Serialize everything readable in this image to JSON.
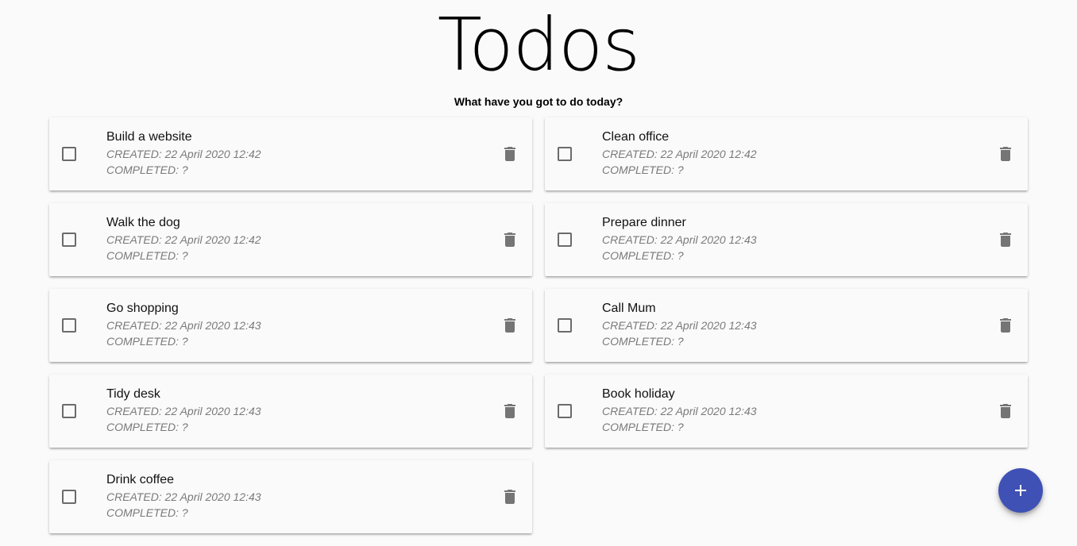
{
  "header": {
    "title": "Todos",
    "subtitle": "What have you got to do today?"
  },
  "todos": [
    {
      "title": "Build a website",
      "created": "CREATED: 22 April 2020 12:42",
      "completed": "COMPLETED: ?",
      "checked": false
    },
    {
      "title": "Clean office",
      "created": "CREATED: 22 April 2020 12:42",
      "completed": "COMPLETED: ?",
      "checked": false
    },
    {
      "title": "Walk the dog",
      "created": "CREATED: 22 April 2020 12:42",
      "completed": "COMPLETED: ?",
      "checked": false
    },
    {
      "title": "Prepare dinner",
      "created": "CREATED: 22 April 2020 12:43",
      "completed": "COMPLETED: ?",
      "checked": false
    },
    {
      "title": "Go shopping",
      "created": "CREATED: 22 April 2020 12:43",
      "completed": "COMPLETED: ?",
      "checked": false
    },
    {
      "title": "Call Mum",
      "created": "CREATED: 22 April 2020 12:43",
      "completed": "COMPLETED: ?",
      "checked": false
    },
    {
      "title": "Tidy desk",
      "created": "CREATED: 22 April 2020 12:43",
      "completed": "COMPLETED: ?",
      "checked": false
    },
    {
      "title": "Book holiday",
      "created": "CREATED: 22 April 2020 12:43",
      "completed": "COMPLETED: ?",
      "checked": false
    },
    {
      "title": "Drink coffee",
      "created": "CREATED: 22 April 2020 12:43",
      "completed": "COMPLETED: ?",
      "checked": false
    }
  ],
  "icons": {
    "checkbox": "checkbox-outline-icon",
    "delete": "trash-icon",
    "add": "plus-icon"
  },
  "colors": {
    "fab": "#3f51b5",
    "icon": "#757575"
  }
}
